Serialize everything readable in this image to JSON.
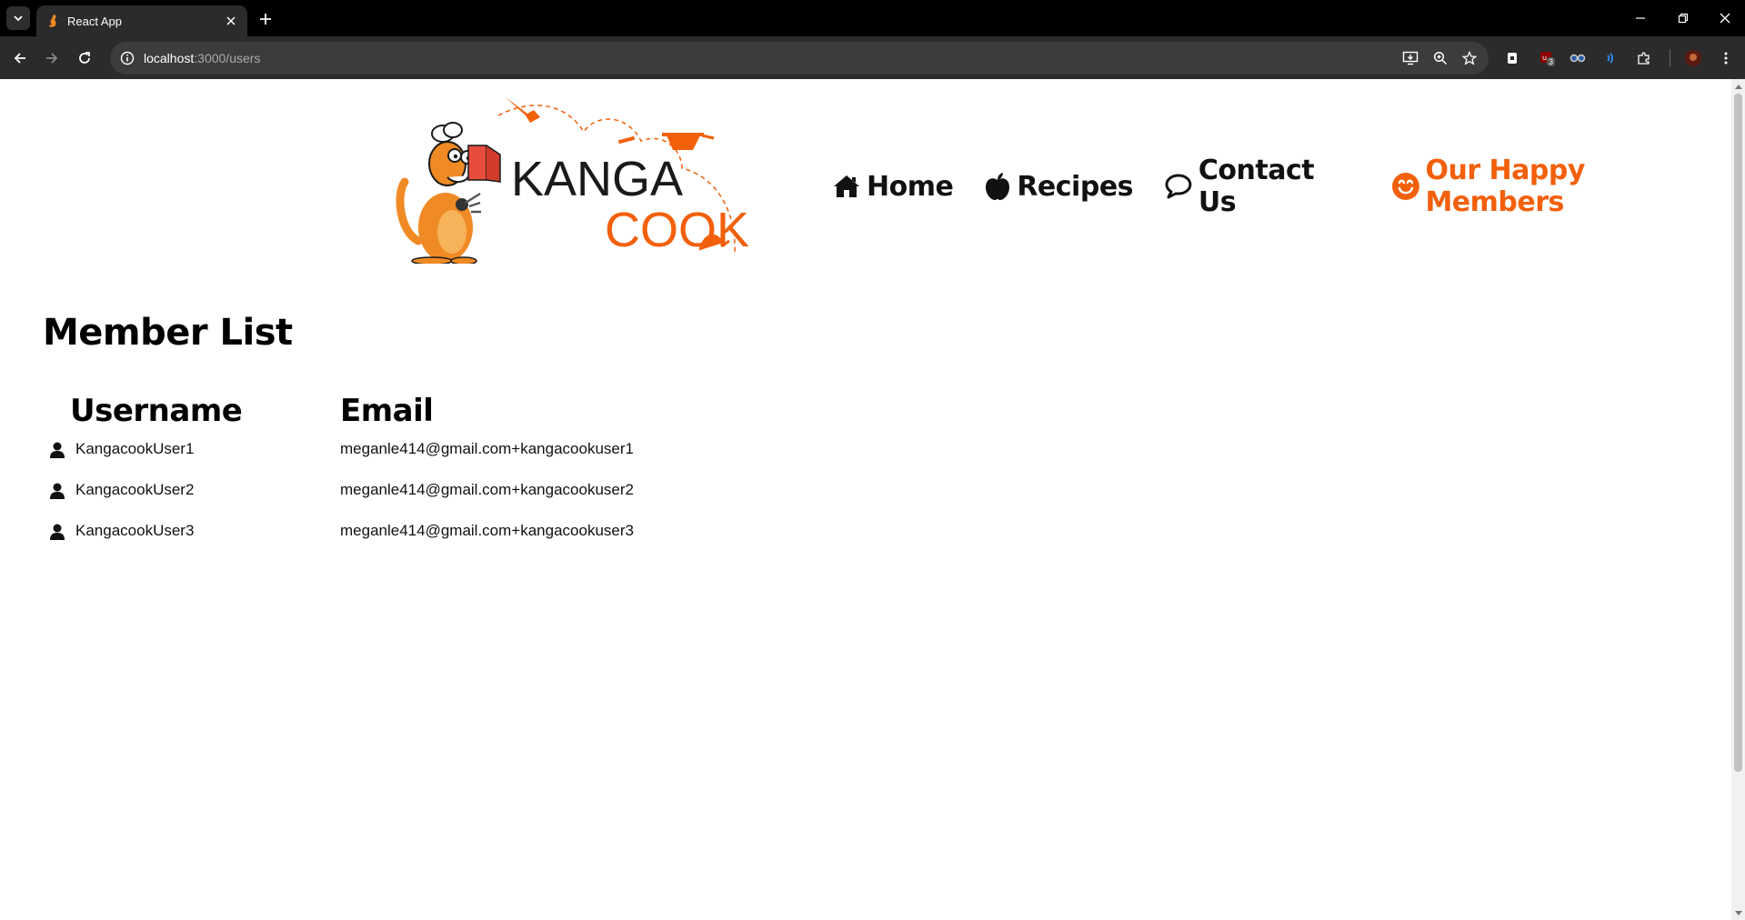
{
  "browser": {
    "tab_title": "React App",
    "url_host": "localhost",
    "url_path": ":3000/users",
    "extension_badge": "3"
  },
  "nav": {
    "items": [
      {
        "label": "Home",
        "icon": "home-icon"
      },
      {
        "label": "Recipes",
        "icon": "apple-icon"
      },
      {
        "label": "Contact Us",
        "icon": "speech-bubble-icon"
      },
      {
        "label": "Our Happy Members",
        "icon": "smiley-icon",
        "active": true
      }
    ],
    "active_color": "#f2600c"
  },
  "logo": {
    "line1": "KANGA",
    "line2": "COOK",
    "brand_color": "#f2600c"
  },
  "page": {
    "title": "Member List",
    "columns": [
      "Username",
      "Email"
    ],
    "members": [
      {
        "username": "KangacookUser1",
        "email": "meganle414@gmail.com+kangacookuser1"
      },
      {
        "username": "KangacookUser2",
        "email": "meganle414@gmail.com+kangacookuser2"
      },
      {
        "username": "KangacookUser3",
        "email": "meganle414@gmail.com+kangacookuser3"
      }
    ]
  }
}
